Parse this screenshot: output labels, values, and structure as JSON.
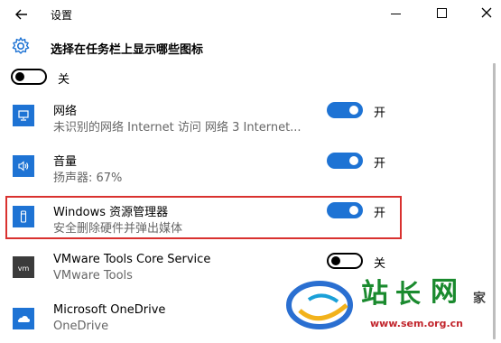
{
  "window": {
    "title": "设置"
  },
  "header": {
    "title": "选择在任务栏上显示哪些图标"
  },
  "top_toggle": {
    "state": "关"
  },
  "apps": [
    {
      "name": "网络",
      "subtitle": "未识别的网络 Internet 访问   网络  3 Internet...",
      "state": "开",
      "icon": "network-icon"
    },
    {
      "name": "音量",
      "subtitle": "扬声器: 67%",
      "state": "开",
      "icon": "volume-icon"
    },
    {
      "name": "Windows 资源管理器",
      "subtitle": "安全删除硬件并弹出媒体",
      "state": "开",
      "icon": "usb-icon"
    },
    {
      "name": "VMware Tools Core Service",
      "subtitle": "VMware Tools",
      "state": "关",
      "icon": "vmware-icon"
    },
    {
      "name": "Microsoft OneDrive",
      "subtitle": "OneDrive",
      "state": "",
      "icon": "onedrive-icon"
    }
  ],
  "watermark": {
    "chars": [
      "站",
      "长",
      "网"
    ],
    "small": "家",
    "url": "www.sem.org.cn"
  },
  "colors": {
    "accent": "#1e73d4",
    "highlight_border": "#d9312f"
  }
}
